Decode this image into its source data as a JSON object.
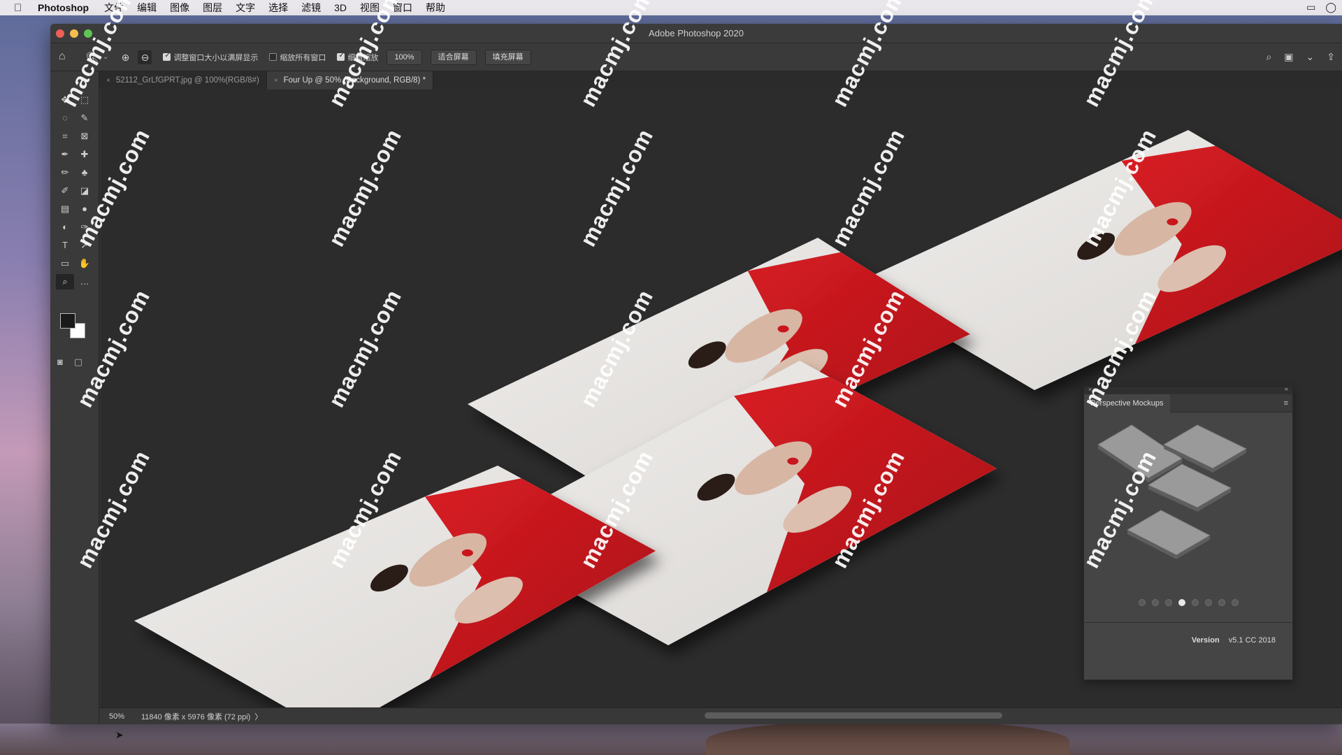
{
  "menubar": {
    "app_name": "Photoshop",
    "items": [
      "文件",
      "编辑",
      "图像",
      "图层",
      "文字",
      "选择",
      "滤镜",
      "3D",
      "视图",
      "窗口",
      "帮助"
    ]
  },
  "window": {
    "title": "Adobe Photoshop 2020"
  },
  "options_bar": {
    "resize_windows_label": "调整窗口大小以满屏显示",
    "zoom_all_label": "缩放所有窗口",
    "scrubby_zoom_label": "细微缩放",
    "zoom_value": "100%",
    "fit_screen_label": "适合屏幕",
    "fill_screen_label": "填充屏幕"
  },
  "tabs": [
    {
      "label": "52112_GrLfGPRT.jpg @ 100%(RGB/8#)",
      "active": false
    },
    {
      "label": "Four Up @ 50% (Background, RGB/8) *",
      "active": true
    }
  ],
  "status": {
    "zoom": "50%",
    "doc_info": "11840 像素 x 5976 像素 (72 ppi)",
    "arrow": "〉"
  },
  "panel": {
    "title": "Perspective Mockups",
    "menu_icon": "hamburger-icon",
    "dot_count": 8,
    "active_dot": 3,
    "version_label": "Version",
    "version_value": "v5.1 CC 2018"
  },
  "watermark": "macmj.com",
  "colors": {
    "scarf_red": "#c8161d",
    "paper": "#e6e4e2",
    "canvas_bg": "#2c2c2c"
  }
}
